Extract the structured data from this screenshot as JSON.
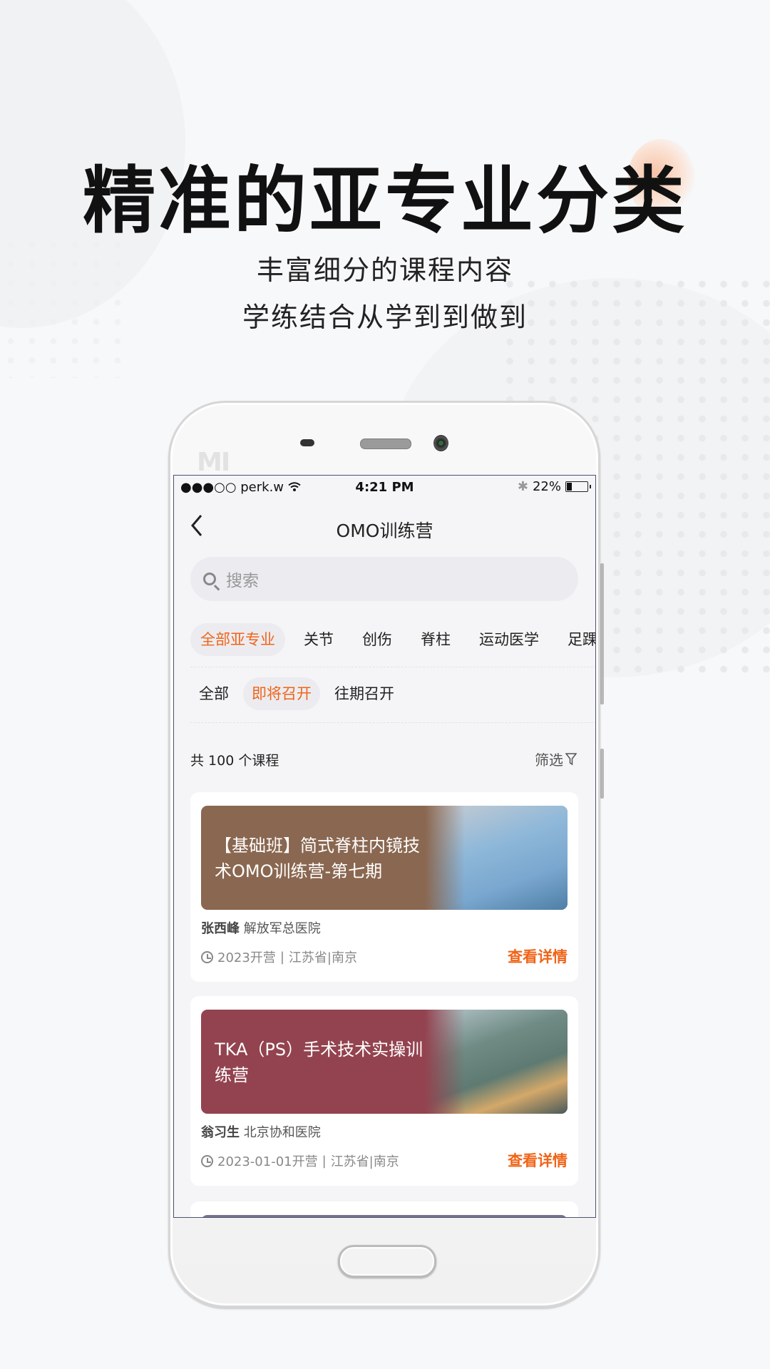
{
  "promo": {
    "headline": "精准的亚专业分类",
    "subline1": "丰富细分的课程内容",
    "subline2": "学练结合从学到到做到",
    "accent_color": "#f06418"
  },
  "device": {
    "brand_logo": "MI"
  },
  "status_bar": {
    "carrier": "●●●○○ perk.w",
    "wifi_icon": "wifi-icon",
    "time": "4:21 PM",
    "bluetooth_icon": "bluetooth-icon",
    "battery_percent": "22%",
    "battery_level": 0.22
  },
  "nav": {
    "back_icon": "chevron-left-icon",
    "title": "OMO训练营"
  },
  "search": {
    "placeholder": "搜索"
  },
  "specialty_tabs": [
    {
      "label": "全部亚专业",
      "active": true
    },
    {
      "label": "关节",
      "active": false
    },
    {
      "label": "创伤",
      "active": false
    },
    {
      "label": "脊柱",
      "active": false
    },
    {
      "label": "运动医学",
      "active": false
    },
    {
      "label": "足踝",
      "active": false
    }
  ],
  "time_tabs": [
    {
      "label": "全部",
      "active": false
    },
    {
      "label": "即将召开",
      "active": true
    },
    {
      "label": "往期召开",
      "active": false
    }
  ],
  "list_header": {
    "count_text": "共 100 个课程",
    "filter_label": "筛选"
  },
  "courses": [
    {
      "title": "【基础班】简式脊柱内镜技术OMO训练营-第七期",
      "doctor": "张西峰",
      "hospital": "解放军总医院",
      "date": "2023开营",
      "location": "江苏省|南京",
      "action": "查看详情",
      "banner_color": "#8a6750"
    },
    {
      "title": "TKA（PS）手术技术实操训练营",
      "doctor": "翁习生",
      "hospital": "北京协和医院",
      "date": "2023-01-01开营",
      "location": "江苏省|南京",
      "action": "查看详情",
      "banner_color": "#93434f"
    }
  ]
}
